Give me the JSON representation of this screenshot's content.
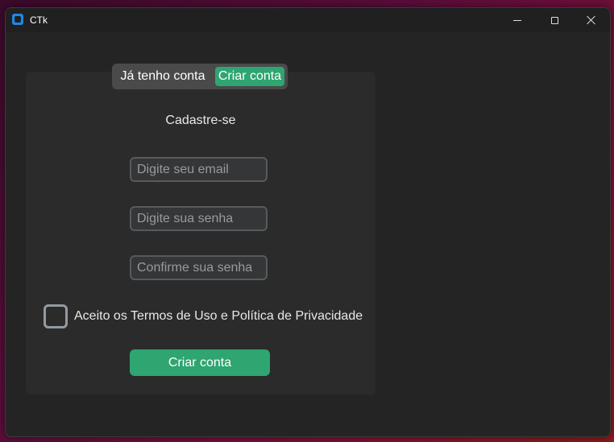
{
  "window": {
    "title": "CTk"
  },
  "tabs": {
    "login_label": "Já tenho conta",
    "register_label": "Criar conta",
    "active": "register"
  },
  "form": {
    "heading": "Cadastre-se",
    "email_placeholder": "Digite seu email",
    "password_placeholder": "Digite sua senha",
    "confirm_placeholder": "Confirme sua senha",
    "terms_label": "Aceito os Termos de Uso e Política de Privacidade",
    "terms_checked": false,
    "submit_label": "Criar conta"
  },
  "colors": {
    "accent": "#2fa572",
    "window_bg": "#242424",
    "card_bg": "#2b2b2b",
    "input_bg": "#343638",
    "input_border": "#565b5e"
  },
  "icons": {
    "app": "ctk-app-icon",
    "minimize": "minimize-icon",
    "maximize": "maximize-icon",
    "close": "close-icon"
  }
}
